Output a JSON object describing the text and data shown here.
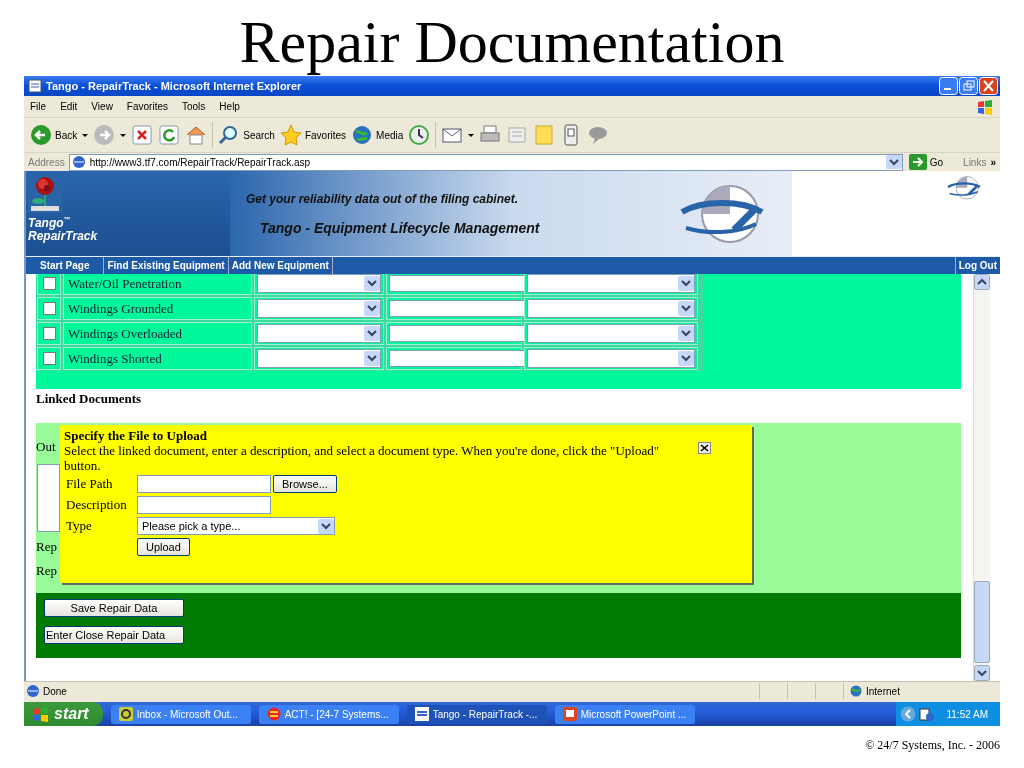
{
  "slide": {
    "title": "Repair Documentation",
    "footer": "© 24/7 Systems, Inc. - 2006"
  },
  "window": {
    "title": "Tango - RepairTrack - Microsoft Internet Explorer"
  },
  "menu": [
    "File",
    "Edit",
    "View",
    "Favorites",
    "Tools",
    "Help"
  ],
  "toolbar": [
    {
      "kind": "back",
      "label": "Back"
    },
    {
      "kind": "forward"
    },
    {
      "kind": "stop"
    },
    {
      "kind": "refresh"
    },
    {
      "kind": "home"
    },
    {
      "kind": "search",
      "label": "Search"
    },
    {
      "kind": "favorites",
      "label": "Favorites"
    },
    {
      "kind": "media",
      "label": "Media"
    },
    {
      "kind": "history"
    },
    {
      "kind": "mail"
    },
    {
      "kind": "print"
    },
    {
      "kind": "edit"
    },
    {
      "kind": "note"
    },
    {
      "kind": "device"
    },
    {
      "kind": "messenger"
    }
  ],
  "address": {
    "label": "Address",
    "url": "http://www3.tf7.com/RepairTrack/RepairTrack.asp",
    "go": "Go",
    "links": "Links",
    "chevron": "»"
  },
  "banner": {
    "product": "Tango",
    "trademark": "™",
    "product_line": "RepairTrack",
    "tagline": "Get your reliability data out of the filing cabinet.",
    "headline": "Tango - Equipment Lifecycle Management"
  },
  "nav": {
    "items": [
      {
        "label": "Start Page",
        "selected": false
      },
      {
        "label": "Find Existing Equipment",
        "selected": false
      },
      {
        "label": "Add New Equipment",
        "selected": false
      }
    ],
    "logout": "Log Out"
  },
  "failure_modes": [
    {
      "name": "Water/Oil Penetration",
      "checked": false
    },
    {
      "name": "Windings Grounded",
      "checked": false
    },
    {
      "name": "Windings Overloaded",
      "checked": false
    },
    {
      "name": "Windings Shorted",
      "checked": false
    }
  ],
  "linked_documents": {
    "heading": "Linked Documents",
    "partial_labels": [
      "Out",
      "Rep",
      "Rep"
    ]
  },
  "upload_dialog": {
    "title": "Specify the File to Upload",
    "instructions": "Select the linked document, enter a description, and select a document type. When you're done, click the \"Upload\" button.",
    "file_path_label": "File Path",
    "browse": "Browse...",
    "description_label": "Description",
    "type_label": "Type",
    "type_value": "Please pick a type...",
    "upload": "Upload"
  },
  "actions": [
    "Save Repair Data",
    "Enter Close Repair Data"
  ],
  "status_bar": {
    "text": "Done",
    "zone": "Internet"
  },
  "taskbar": {
    "start": "start",
    "tasks": [
      {
        "label": "Inbox - Microsoft Out...",
        "kind": "mail",
        "selected": false
      },
      {
        "label": "ACT! - [24-7 Systems...",
        "kind": "contacts",
        "selected": false
      },
      {
        "label": "Tango - RepairTrack -...",
        "kind": "browser",
        "selected": true
      },
      {
        "label": "Microsoft PowerPoint ...",
        "kind": "slides",
        "selected": false
      }
    ],
    "clock": "11:52 AM"
  }
}
